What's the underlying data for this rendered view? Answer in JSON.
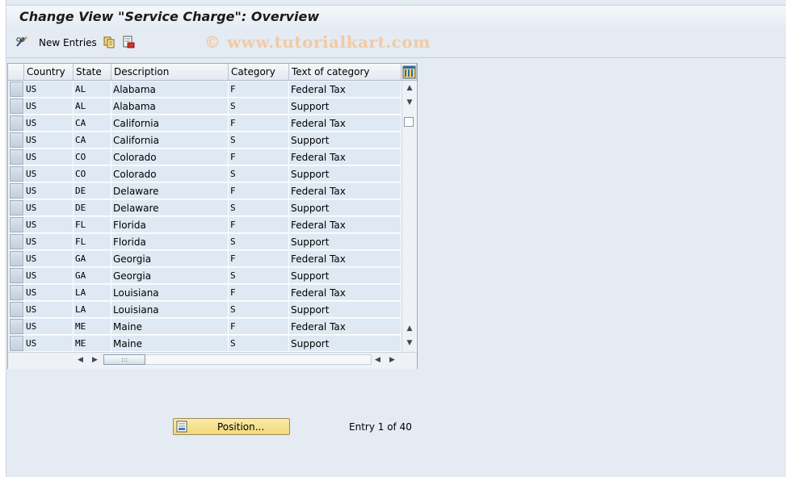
{
  "title": "Change View \"Service Charge\": Overview",
  "toolbar": {
    "new_entries_label": "New Entries",
    "icons": [
      "pencil-glasses-icon",
      "copy-icon",
      "delete-icon"
    ]
  },
  "watermark": "© www.tutorialkart.com",
  "table": {
    "headers": [
      "Country",
      "State",
      "Description",
      "Category",
      "Text of category"
    ],
    "rows": [
      [
        "US",
        "AL",
        "Alabama",
        "F",
        "Federal Tax"
      ],
      [
        "US",
        "AL",
        "Alabama",
        "S",
        "Support"
      ],
      [
        "US",
        "CA",
        "California",
        "F",
        "Federal Tax"
      ],
      [
        "US",
        "CA",
        "California",
        "S",
        "Support"
      ],
      [
        "US",
        "CO",
        "Colorado",
        "F",
        "Federal Tax"
      ],
      [
        "US",
        "CO",
        "Colorado",
        "S",
        "Support"
      ],
      [
        "US",
        "DE",
        "Delaware",
        "F",
        "Federal Tax"
      ],
      [
        "US",
        "DE",
        "Delaware",
        "S",
        "Support"
      ],
      [
        "US",
        "FL",
        "Florida",
        "F",
        "Federal Tax"
      ],
      [
        "US",
        "FL",
        "Florida",
        "S",
        "Support"
      ],
      [
        "US",
        "GA",
        "Georgia",
        "F",
        "Federal Tax"
      ],
      [
        "US",
        "GA",
        "Georgia",
        "S",
        "Support"
      ],
      [
        "US",
        "LA",
        "Louisiana",
        "F",
        "Federal Tax"
      ],
      [
        "US",
        "LA",
        "Louisiana",
        "S",
        "Support"
      ],
      [
        "US",
        "ME",
        "Maine",
        "F",
        "Federal Tax"
      ],
      [
        "US",
        "ME",
        "Maine",
        "S",
        "Support"
      ]
    ]
  },
  "position_button_label": "Position...",
  "entry_status": "Entry 1 of 40",
  "colors": {
    "row_bg": "#dfe9f3",
    "button_bg": "#f2d97a",
    "watermark": "#f2c9a6"
  }
}
